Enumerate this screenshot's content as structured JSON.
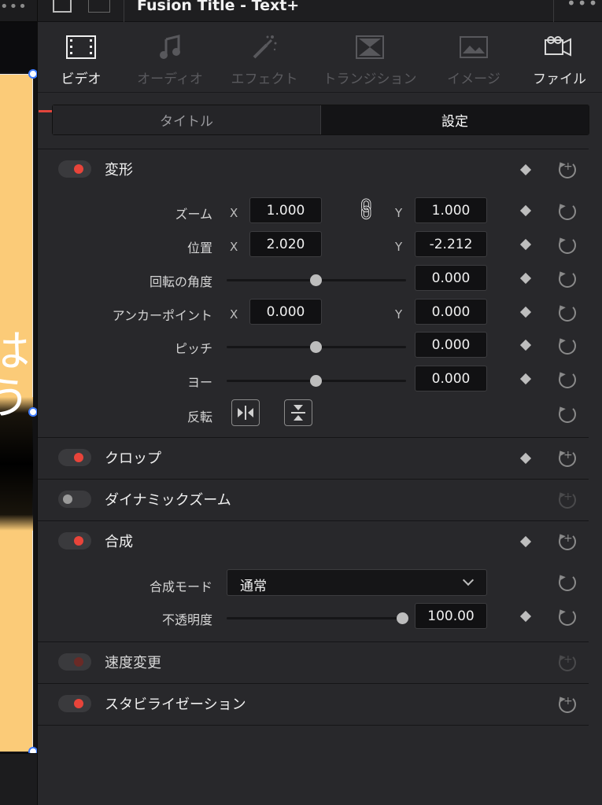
{
  "window": {
    "title": "Fusion Title - Text+",
    "menu_glyph": "•••"
  },
  "viewer": {
    "menu_glyph": "•••",
    "text_line1": "は",
    "text_line2": "う"
  },
  "tabs": [
    {
      "label": "ビデオ",
      "icon": "film-icon",
      "state": "active"
    },
    {
      "label": "オーディオ",
      "icon": "music-note-icon",
      "state": "disabled"
    },
    {
      "label": "エフェクト",
      "icon": "magic-wand-icon",
      "state": "disabled"
    },
    {
      "label": "トランジション",
      "icon": "transition-icon",
      "state": "disabled"
    },
    {
      "label": "イメージ",
      "icon": "image-icon",
      "state": "disabled"
    },
    {
      "label": "ファイル",
      "icon": "file-icon",
      "state": "enabled"
    }
  ],
  "segment": {
    "left": "タイトル",
    "right": "設定",
    "selected": "設定"
  },
  "transform": {
    "label": "変形",
    "zoom": {
      "label": "ズーム",
      "x": "1.000",
      "y": "1.000",
      "x_label": "X",
      "y_label": "Y"
    },
    "position": {
      "label": "位置",
      "x": "2.020",
      "y": "-2.212",
      "x_label": "X",
      "y_label": "Y"
    },
    "rotation": {
      "label": "回転の角度",
      "value": "0.000",
      "slider_fraction": 0.5
    },
    "anchor": {
      "label": "アンカーポイント",
      "x": "0.000",
      "y": "0.000",
      "x_label": "X",
      "y_label": "Y"
    },
    "pitch": {
      "label": "ピッチ",
      "value": "0.000",
      "slider_fraction": 0.5
    },
    "yaw": {
      "label": "ヨー",
      "value": "0.000",
      "slider_fraction": 0.5
    },
    "flip": {
      "label": "反転"
    }
  },
  "crop": {
    "label": "クロップ"
  },
  "dynamic_zoom": {
    "label": "ダイナミックズーム"
  },
  "composite": {
    "label": "合成",
    "mode": {
      "label": "合成モード",
      "value": "通常"
    },
    "opacity": {
      "label": "不透明度",
      "value": "100.00",
      "slider_fraction": 1.0
    }
  },
  "speed_change": {
    "label": "速度変更"
  },
  "stabilization": {
    "label": "スタビライゼーション"
  },
  "colors": {
    "accent": "#e2453c",
    "panel": "#28282b",
    "field": "#111113"
  }
}
